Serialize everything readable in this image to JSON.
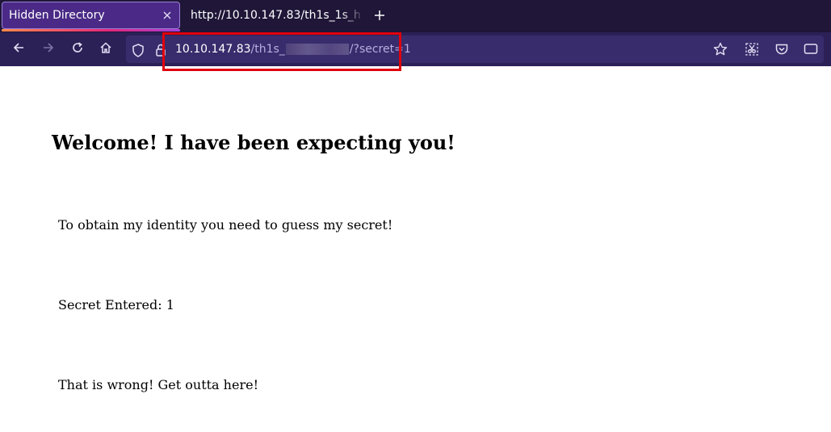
{
  "browser": {
    "tabs": [
      {
        "title": "Hidden Directory",
        "active": true
      },
      {
        "title": "http://10.10.147.83/th1s_1s_h",
        "active": false
      }
    ],
    "url": {
      "host": "10.10.147.83",
      "path_visible": "/th1s_",
      "query": "/?secret=1"
    },
    "colors": {
      "tabbar": "#1f1638",
      "navbar": "#2b2157",
      "urlbar": "#392c6c",
      "active_tab": "#4a2a86",
      "highlight_box": "#e0000c"
    },
    "icons": {
      "tab_close": "close-icon",
      "new_tab": "plus-icon",
      "nav": [
        "back-arrow-icon",
        "forward-arrow-icon",
        "reload-icon",
        "home-icon"
      ],
      "url_left": [
        "shield-icon",
        "lock-icon"
      ],
      "right": [
        "star-icon",
        "screenshot-icon",
        "pocket-icon",
        "reader-view-icon"
      ]
    }
  },
  "page": {
    "heading": "Welcome! I have been expecting you!",
    "intro": "To obtain my identity you need to guess my secret!",
    "secret_entered": "Secret Entered: 1",
    "result": "That is wrong! Get outta here!"
  }
}
